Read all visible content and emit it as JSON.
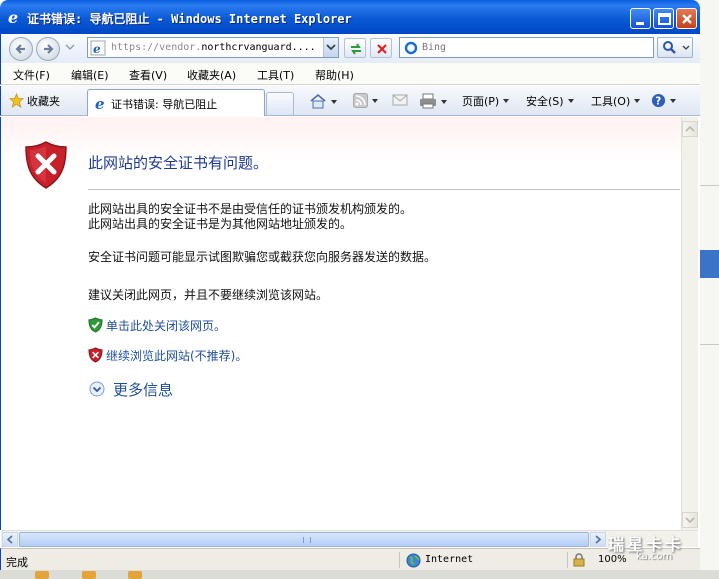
{
  "window": {
    "title": "证书错误: 导航已阻止 - Windows Internet Explorer"
  },
  "address_bar": {
    "url_prefix": "https://vendor.",
    "url_host": "northcrvanguard....",
    "search_placeholder": "Bing"
  },
  "menu": {
    "items": [
      "文件(F)",
      "编辑(E)",
      "查看(V)",
      "收藏夹(A)",
      "工具(T)",
      "帮助(H)"
    ]
  },
  "toolbar": {
    "favorites_label": "收藏夹",
    "tab_title": "证书错误: 导航已阻止",
    "page_label": "页面(P)",
    "safety_label": "安全(S)",
    "tools_label": "工具(O)"
  },
  "content": {
    "heading": "此网站的安全证书有问题。",
    "paragraph1_line1": "此网站出具的安全证书不是由受信任的证书颁发机构颁发的。",
    "paragraph1_line2": "此网站出具的安全证书是为其他网站地址颁发的。",
    "paragraph2": "安全证书问题可能显示试图欺骗您或截获您向服务器发送的数据。",
    "paragraph3": "建议关闭此网页，并且不要继续浏览该网站。",
    "close_link": "单击此处关闭该网页。",
    "continue_link": "继续浏览此网站(不推荐)。",
    "more_info": "更多信息"
  },
  "status_bar": {
    "status": "完成",
    "zone": "Internet",
    "zoom": "100%"
  },
  "watermark": {
    "text": "瑞星卡卡",
    "url": "ka.com"
  },
  "colors": {
    "titlebar": "#0a5ad6",
    "link": "#1f4f9d",
    "heading": "#1f3a93",
    "shield_red": "#c8202a",
    "shield_green": "#2e9a3a"
  },
  "icons": [
    "ie-icon",
    "minimize-icon",
    "maximize-icon",
    "close-icon",
    "back-icon",
    "forward-icon",
    "refresh-icon",
    "stop-icon",
    "bing-icon",
    "search-icon",
    "star-icon",
    "home-icon",
    "rss-icon",
    "mail-icon",
    "print-icon",
    "help-icon",
    "shield-error-icon",
    "shield-ok-icon",
    "expand-icon",
    "globe-icon",
    "security-lock-icon"
  ]
}
